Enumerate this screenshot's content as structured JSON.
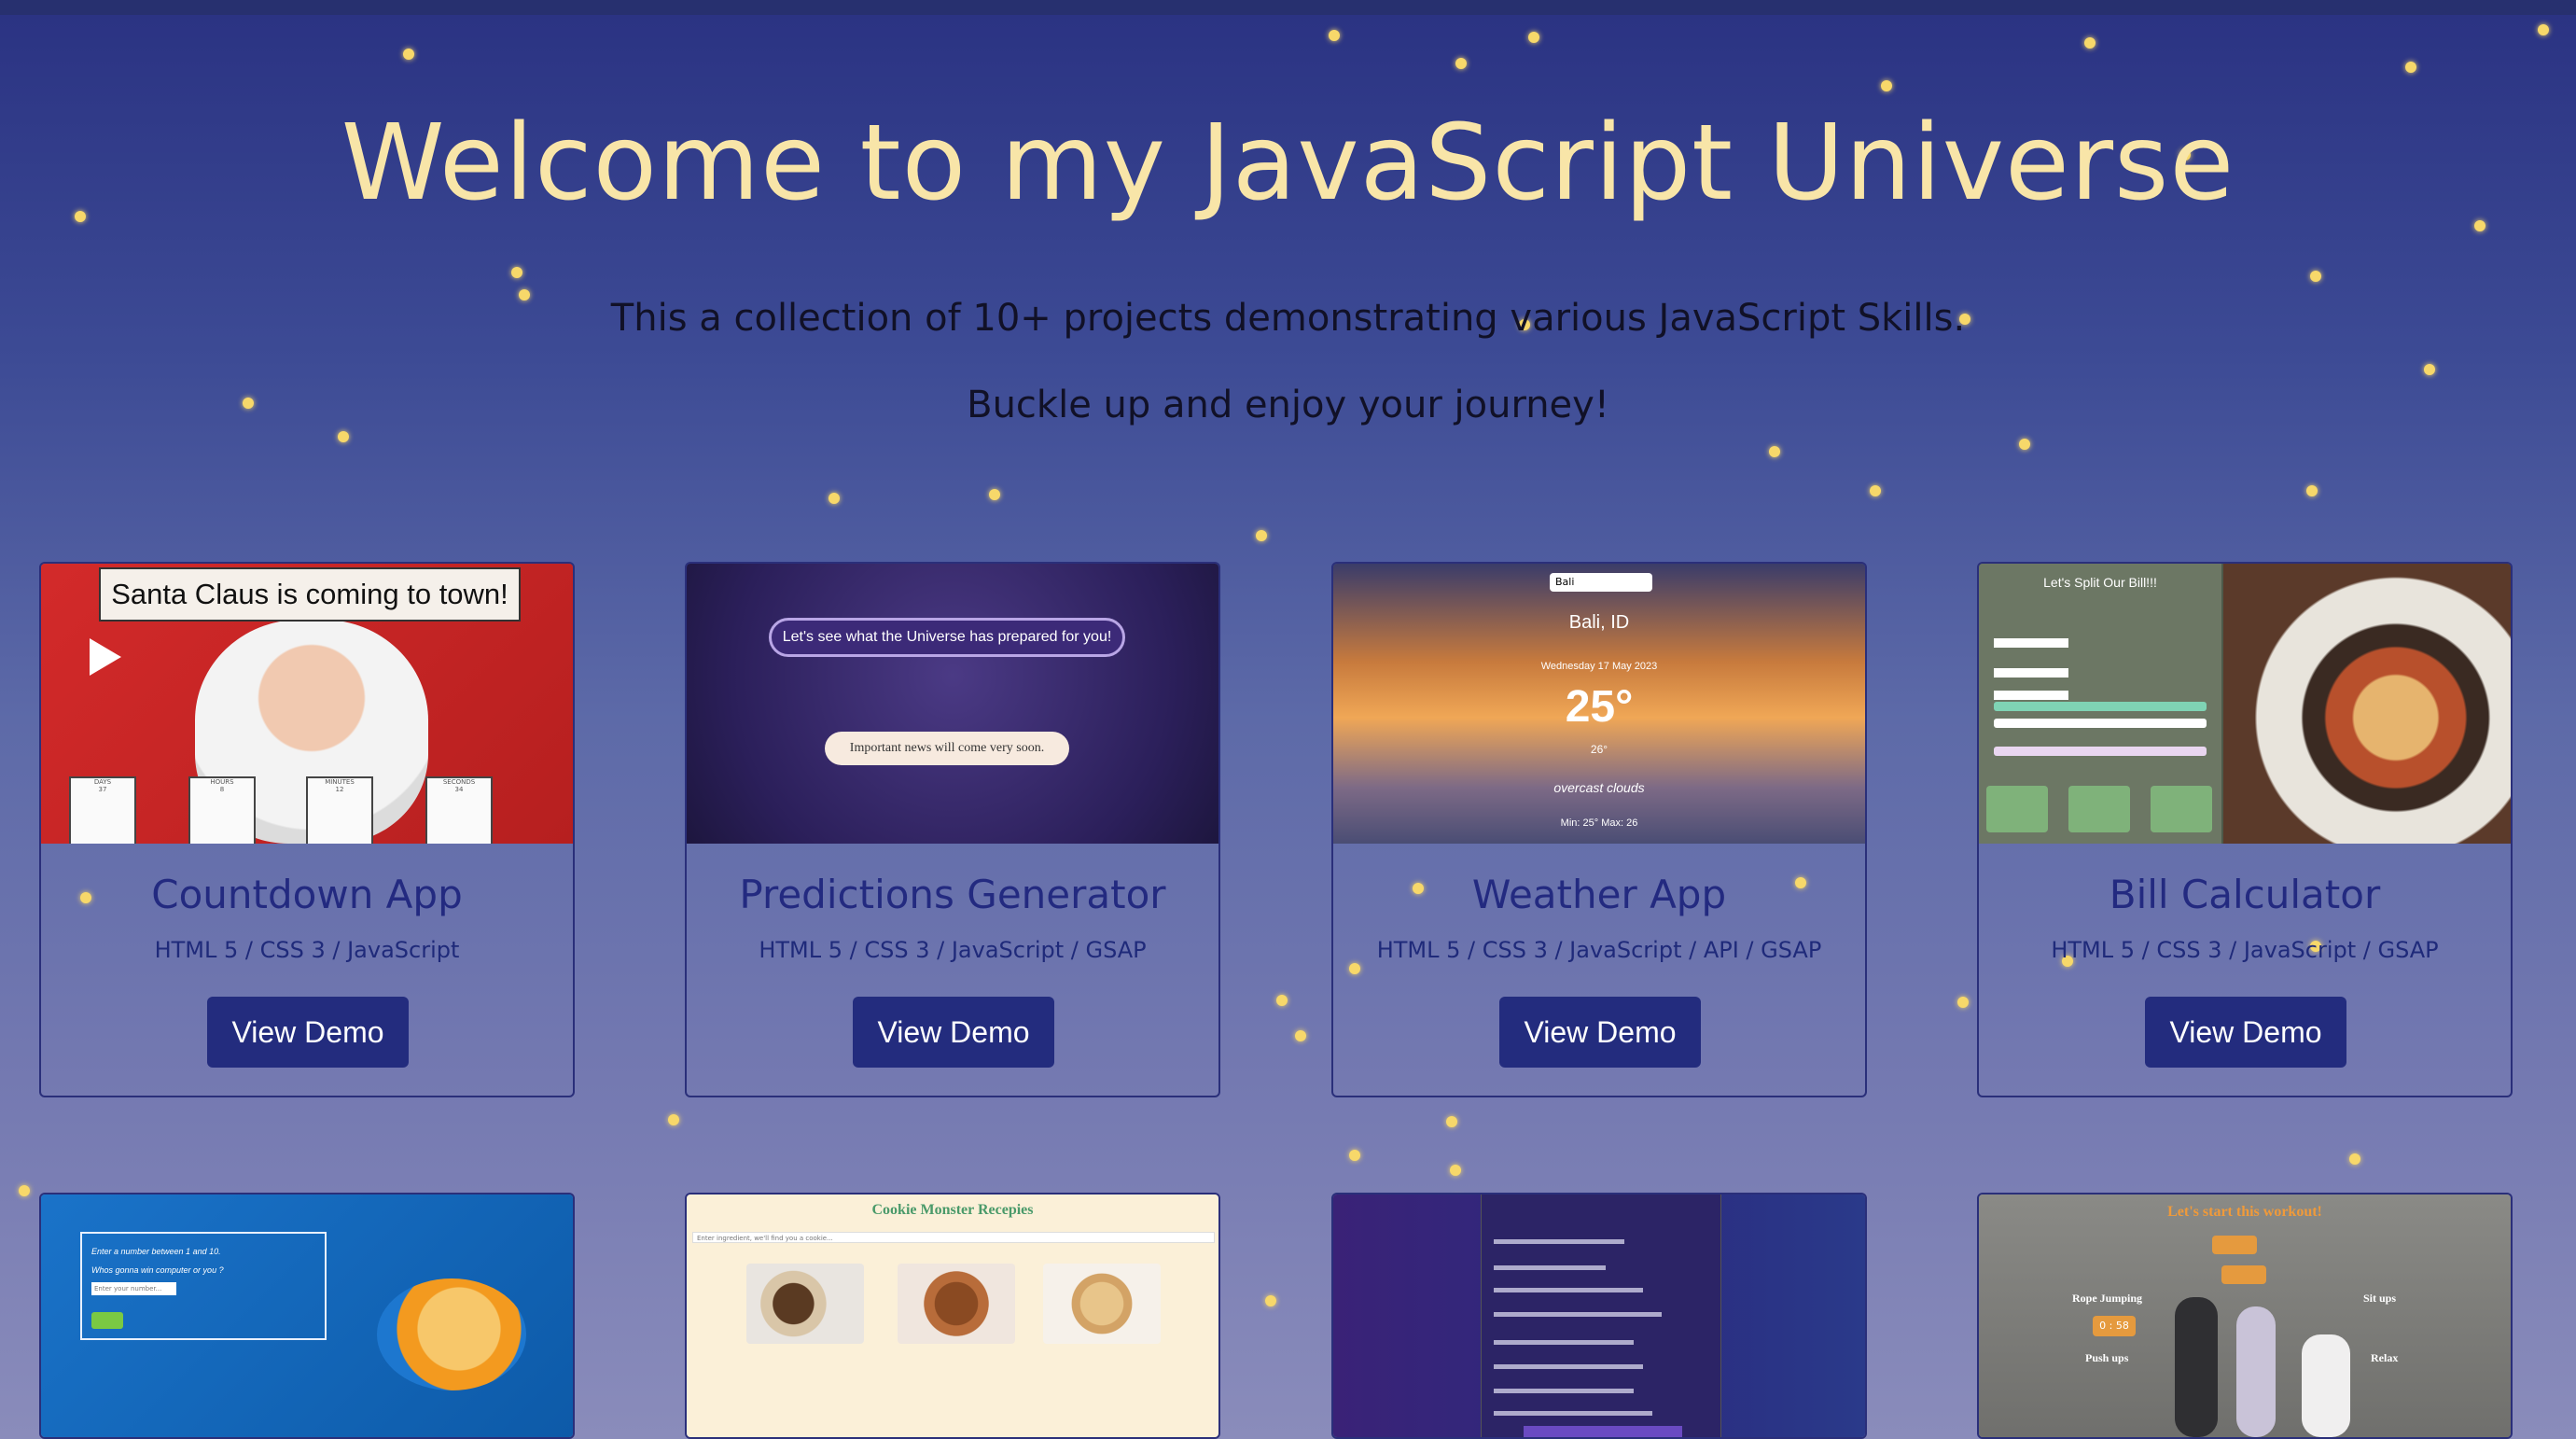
{
  "header": {
    "title": "Welcome to my JavaScript Universe",
    "subtitle1": "This a collection of 10+ projects demonstrating various JavaScript Skills.",
    "subtitle2": "Buckle up and enjoy your journey!"
  },
  "colors": {
    "title": "#f8e5a8",
    "star": "#f7d86a",
    "button": "#232c7e",
    "card_text": "#232a80"
  },
  "projects": [
    {
      "name": "Countdown App",
      "tech": "HTML 5 / CSS 3 / JavaScript",
      "button": "View Demo",
      "preview": {
        "banner": "Santa Claus is coming to town!",
        "labels": [
          "DAYS",
          "HOURS",
          "MINUTES",
          "SECONDS"
        ],
        "values": [
          "37",
          "8",
          "12",
          "34"
        ]
      }
    },
    {
      "name": "Predictions Generator",
      "tech": "HTML 5 / CSS 3 / JavaScript / GSAP",
      "button": "View Demo",
      "preview": {
        "prompt": "Let's see what the Universe has prepared for you!",
        "message": "Important news will come very soon."
      }
    },
    {
      "name": "Weather App",
      "tech": "HTML 5 / CSS 3 / JavaScript / API / GSAP",
      "button": "View Demo",
      "preview": {
        "search": "Bali",
        "city": "Bali, ID",
        "date": "Wednesday 17 May 2023",
        "temp": "25°",
        "feels": "26°",
        "desc": "overcast clouds",
        "minmax": "Min: 25° Max: 26"
      }
    },
    {
      "name": "Bill Calculator",
      "tech": "HTML 5 / CSS 3 / JavaScript / GSAP",
      "button": "View Demo",
      "preview": {
        "title": "Let's Split Our Bill!!!"
      }
    },
    {
      "name": "",
      "tech": "",
      "button": "",
      "preview": {
        "line1": "Enter a number between 1 and 10.",
        "line2": "Whos gonna win computer or you ?",
        "placeholder": "Enter your number..."
      }
    },
    {
      "name": "",
      "tech": "",
      "button": "",
      "preview": {
        "title": "Cookie Monster Recepies",
        "placeholder": "Enter ingredient, we'll find you a cookie..."
      }
    },
    {
      "name": "",
      "tech": "",
      "button": "",
      "preview": {}
    },
    {
      "name": "",
      "tech": "",
      "button": "",
      "preview": {
        "title": "Let's start this workout!",
        "labels": [
          "Rope Jumping",
          "Sit ups",
          "Push ups",
          "Relax"
        ],
        "timer": "0 : 58"
      }
    }
  ]
}
